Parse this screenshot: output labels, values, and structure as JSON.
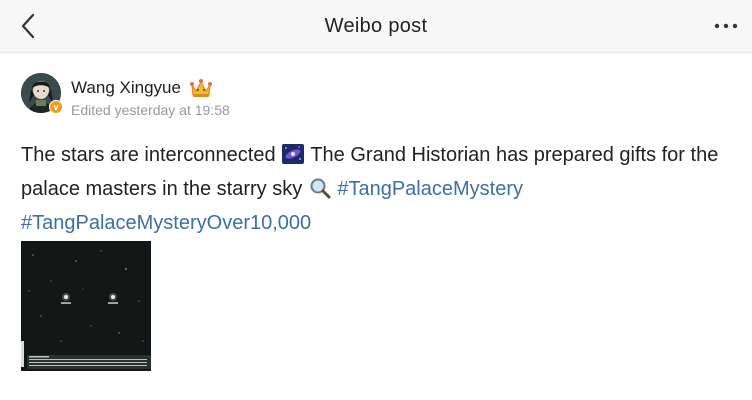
{
  "header": {
    "title": "Weibo post",
    "back_icon": "chevron-left-icon",
    "more_icon": "more-horizontal-icon"
  },
  "author": {
    "name": "Wang Xingyue",
    "verified_badge": "v",
    "badge_color": "#f59a23",
    "time": "Edited yesterday at 19:58"
  },
  "post": {
    "text_part1": "The stars are interconnected ",
    "text_part2": " The Grand Historian has prepared gifts for the palace masters in the starry sky ",
    "hashtag1": "#TangPalaceMystery",
    "hashtag2": "#TangPalaceMysteryOver10,000",
    "link_color": "#3d6ea8",
    "emoji1": "galaxy-emoji",
    "emoji2": "magnifier-emoji"
  },
  "media": {
    "image": "starry-sky-game-screenshot"
  }
}
